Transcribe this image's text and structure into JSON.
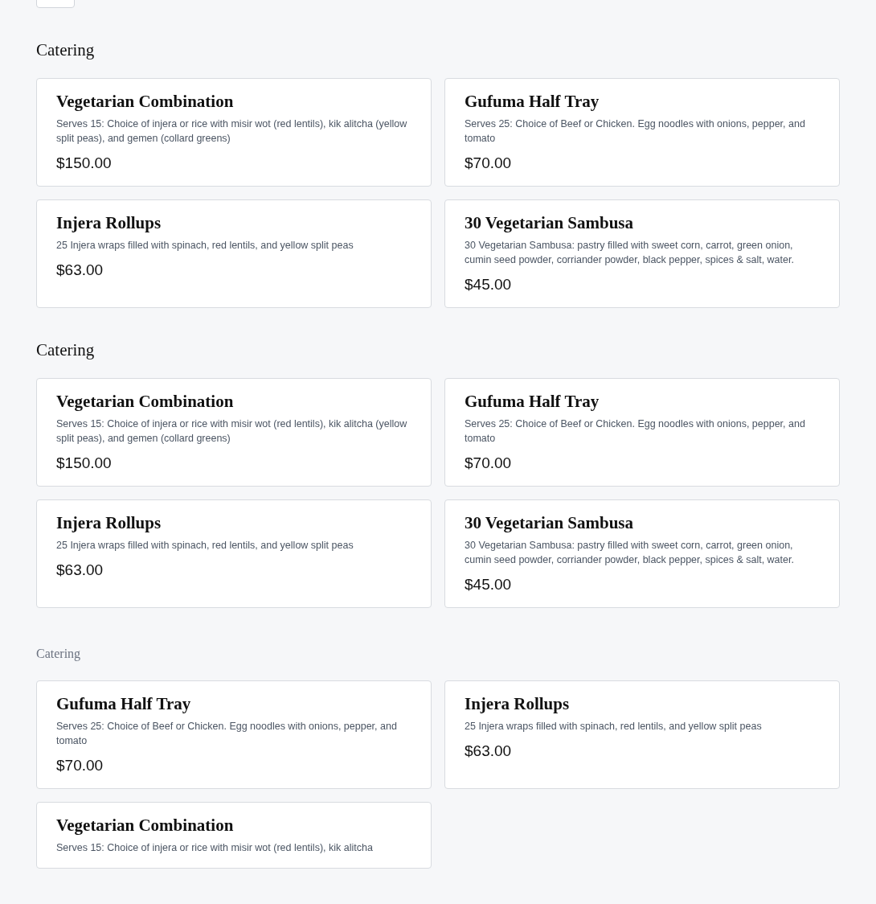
{
  "sections": [
    {
      "heading": "Catering",
      "muted": false,
      "items": [
        {
          "title": "Vegetarian Combination",
          "description": "Serves 15: Choice of injera or rice with misir wot (red lentils), kik alitcha (yellow split peas), and gemen (collard greens)",
          "price": "$150.00"
        },
        {
          "title": "Gufuma Half Tray",
          "description": "Serves 25: Choice of Beef or Chicken. Egg noodles with onions, pepper, and tomato",
          "price": "$70.00"
        },
        {
          "title": "Injera Rollups",
          "description": "25 Injera wraps filled with spinach, red lentils, and yellow split peas",
          "price": "$63.00"
        },
        {
          "title": "30 Vegetarian Sambusa",
          "description": "30 Vegetarian Sambusa: pastry filled with sweet corn, carrot, green onion, cumin seed powder, corriander powder, black pepper, spices & salt, water.",
          "price": "$45.00"
        }
      ]
    },
    {
      "heading": "Catering",
      "muted": false,
      "items": [
        {
          "title": "Vegetarian Combination",
          "description": "Serves 15: Choice of injera or rice with misir wot (red lentils), kik alitcha (yellow split peas), and gemen (collard greens)",
          "price": "$150.00"
        },
        {
          "title": "Gufuma Half Tray",
          "description": "Serves 25: Choice of Beef or Chicken. Egg noodles with onions, pepper, and tomato",
          "price": "$70.00"
        },
        {
          "title": "Injera Rollups",
          "description": "25 Injera wraps filled with spinach, red lentils, and yellow split peas",
          "price": "$63.00"
        },
        {
          "title": "30 Vegetarian Sambusa",
          "description": "30 Vegetarian Sambusa: pastry filled with sweet corn, carrot, green onion, cumin seed powder, corriander powder, black pepper, spices & salt, water.",
          "price": "$45.00"
        }
      ]
    },
    {
      "heading": "Catering",
      "muted": true,
      "items": [
        {
          "title": "Gufuma Half Tray",
          "description": "Serves 25: Choice of Beef or Chicken. Egg noodles with onions, pepper, and tomato",
          "price": "$70.00"
        },
        {
          "title": "Injera Rollups",
          "description": "25 Injera wraps filled with spinach, red lentils, and yellow split peas",
          "price": "$63.00"
        },
        {
          "title": "Vegetarian Combination",
          "description": "Serves 15: Choice of injera or rice with misir wot (red lentils), kik alitcha"
        }
      ]
    }
  ]
}
